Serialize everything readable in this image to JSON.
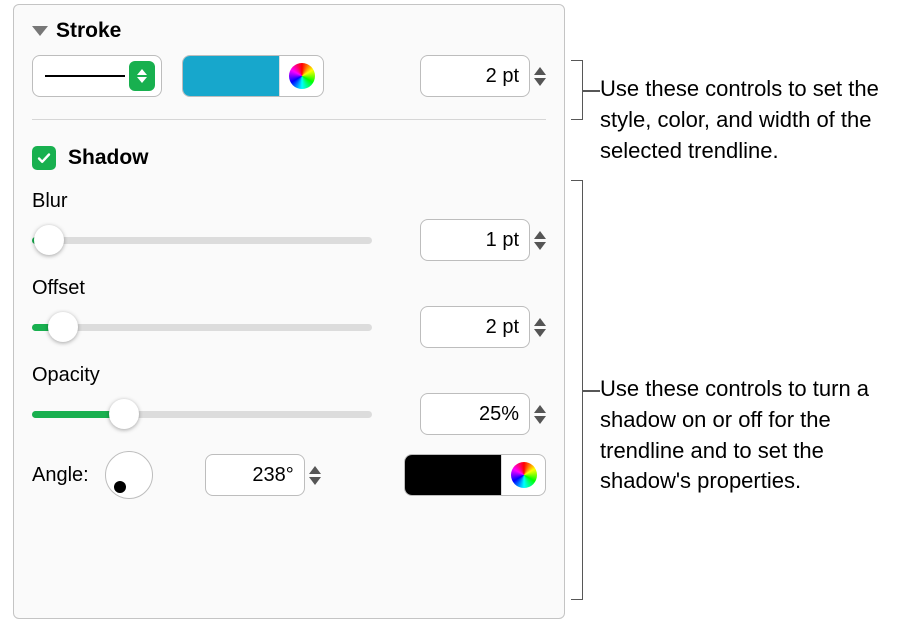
{
  "stroke": {
    "title": "Stroke",
    "style": "solid",
    "color": "#17a7cc",
    "width_display": "2 pt"
  },
  "shadow": {
    "title": "Shadow",
    "enabled": true,
    "blur": {
      "label": "Blur",
      "value_display": "1 pt",
      "percent": 2
    },
    "offset": {
      "label": "Offset",
      "value_display": "2 pt",
      "percent": 7
    },
    "opacity": {
      "label": "Opacity",
      "value_display": "25%",
      "percent": 25
    },
    "angle": {
      "label": "Angle:",
      "value_display": "238°",
      "degrees": 238
    },
    "color": "#000000"
  },
  "annotations": {
    "stroke": "Use these controls to set the style, color, and width of the selected trendline.",
    "shadow": "Use these controls to turn a shadow on or off for the trendline and to set the shadow's properties."
  }
}
